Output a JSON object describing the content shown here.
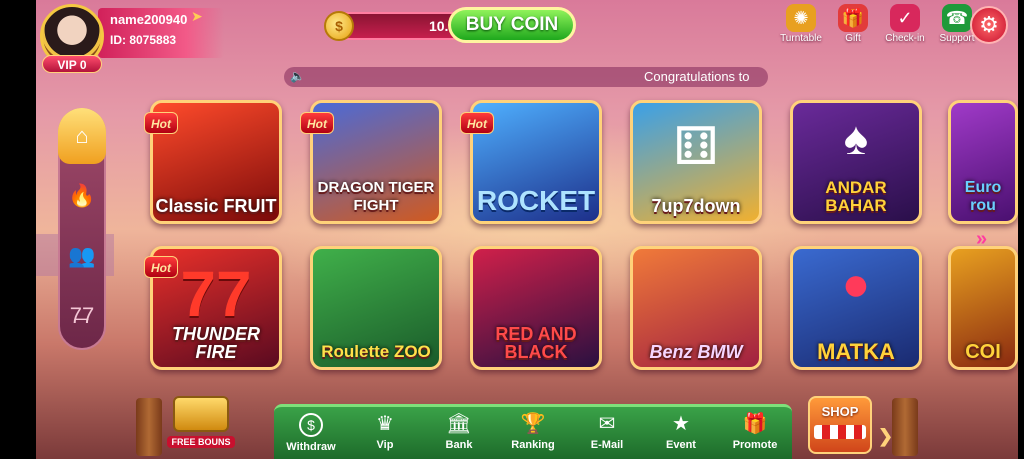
{
  "user": {
    "name": "name200940",
    "id": "ID: 8075883",
    "vip": "VIP 0"
  },
  "wallet": {
    "coin_symbol": "$",
    "balance": "10.00",
    "buy_label": "BUY COIN"
  },
  "top_actions": [
    {
      "label": "Turntable",
      "icon": "turntable-icon",
      "color": "#e8a020"
    },
    {
      "label": "Gift",
      "icon": "gift-icon",
      "color": "#e23b3b"
    },
    {
      "label": "Check-in",
      "icon": "check-in-icon",
      "color": "#d8285c"
    },
    {
      "label": "Support",
      "icon": "support-icon",
      "color": "#1f9a3a"
    }
  ],
  "marquee": {
    "text": "Congratulations to"
  },
  "left_nav": [
    "home-icon",
    "hot-icon",
    "multiplayer-icon",
    "slots-icon"
  ],
  "games": [
    {
      "title": "Classic FRUIT",
      "hot": "Hot",
      "color1": "#ff4b2b",
      "color2": "#7a0a0a"
    },
    {
      "title": "DRAGON TIGER FIGHT",
      "hot": "Hot",
      "color1": "#4a6ad8",
      "color2": "#d05a20"
    },
    {
      "title": "ROCKET",
      "hot": "Hot",
      "color1": "#4fb0ff",
      "color2": "#1d2f8a"
    },
    {
      "title": "7up7down",
      "hot": "",
      "color1": "#3aa0e8",
      "color2": "#f0b030"
    },
    {
      "title": "ANDAR BAHAR",
      "hot": "",
      "color1": "#6a2a9a",
      "color2": "#2a0f4a"
    },
    {
      "title": "Euro rou",
      "hot": "",
      "color1": "#a03ac8",
      "color2": "#4a1070"
    },
    {
      "title": "THUNDER FIRE",
      "hot": "Hot",
      "color1": "#e8302a",
      "color2": "#5a0a20"
    },
    {
      "title": "Roulette ZOO",
      "hot": "",
      "color1": "#40b04a",
      "color2": "#1a5a2a"
    },
    {
      "title": "RED AND BLACK",
      "hot": "",
      "color1": "#d0204a",
      "color2": "#2a1040"
    },
    {
      "title": "Benz BMW",
      "hot": "",
      "color1": "#f07a3a",
      "color2": "#a02040"
    },
    {
      "title": "MATKA",
      "hot": "",
      "color1": "#3a6ad0",
      "color2": "#1a2a70"
    },
    {
      "title": "COI",
      "hot": "",
      "color1": "#e8a020",
      "color2": "#8a2a10"
    }
  ],
  "bottom_nav": [
    {
      "label": "Withdraw",
      "icon": "withdraw-icon",
      "glyph": "$"
    },
    {
      "label": "Vip",
      "icon": "vip-icon",
      "glyph": "♛"
    },
    {
      "label": "Bank",
      "icon": "bank-icon",
      "glyph": "🏛"
    },
    {
      "label": "Ranking",
      "icon": "ranking-icon",
      "glyph": "🏆"
    },
    {
      "label": "E-Mail",
      "icon": "email-icon",
      "glyph": "✉"
    },
    {
      "label": "Event",
      "icon": "event-icon",
      "glyph": "★"
    },
    {
      "label": "Promote",
      "icon": "promote-icon",
      "glyph": "🎁"
    }
  ],
  "free_bonus": "FREE BOUNS",
  "shop": "SHOP"
}
